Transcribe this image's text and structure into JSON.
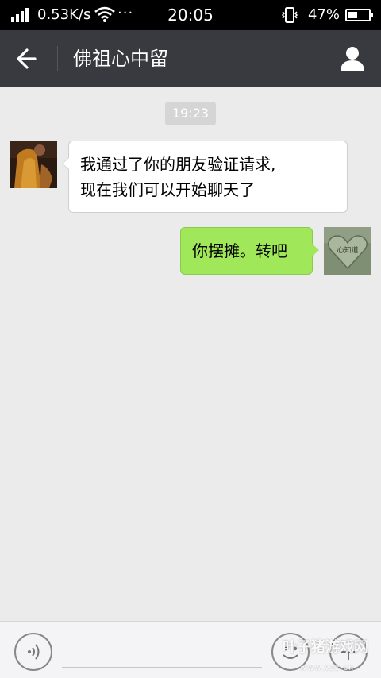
{
  "status_bar": {
    "network_speed": "0.53K/s",
    "more_dots": "···",
    "time": "20:05",
    "battery_percent": "47%",
    "battery_level": 0.47,
    "icons": [
      "signal-icon",
      "wifi-icon",
      "vibrate-icon",
      "battery-icon"
    ]
  },
  "header": {
    "title": "佛祖心中留",
    "back_icon": "back-arrow-icon",
    "profile_icon": "person-icon"
  },
  "chat": {
    "timestamp": "19:23",
    "messages": [
      {
        "side": "left",
        "lines": [
          "我通过了你的朋友验证请求,",
          "现在我们可以开始聊天了"
        ]
      },
      {
        "side": "right",
        "text": "你摆摊。转吧",
        "avatar_text": "心知道"
      }
    ]
  },
  "input_bar": {
    "value": "",
    "icons": [
      "voice-icon",
      "emoji-icon",
      "plus-icon"
    ]
  },
  "watermark": {
    "text": "叶子猪游戏网",
    "url": "www.yzz.cn"
  },
  "colors": {
    "header_bg": "#393a3f",
    "chat_bg": "#ebebeb",
    "bubble_self": "#a0e75a",
    "bubble_other": "#ffffff"
  }
}
